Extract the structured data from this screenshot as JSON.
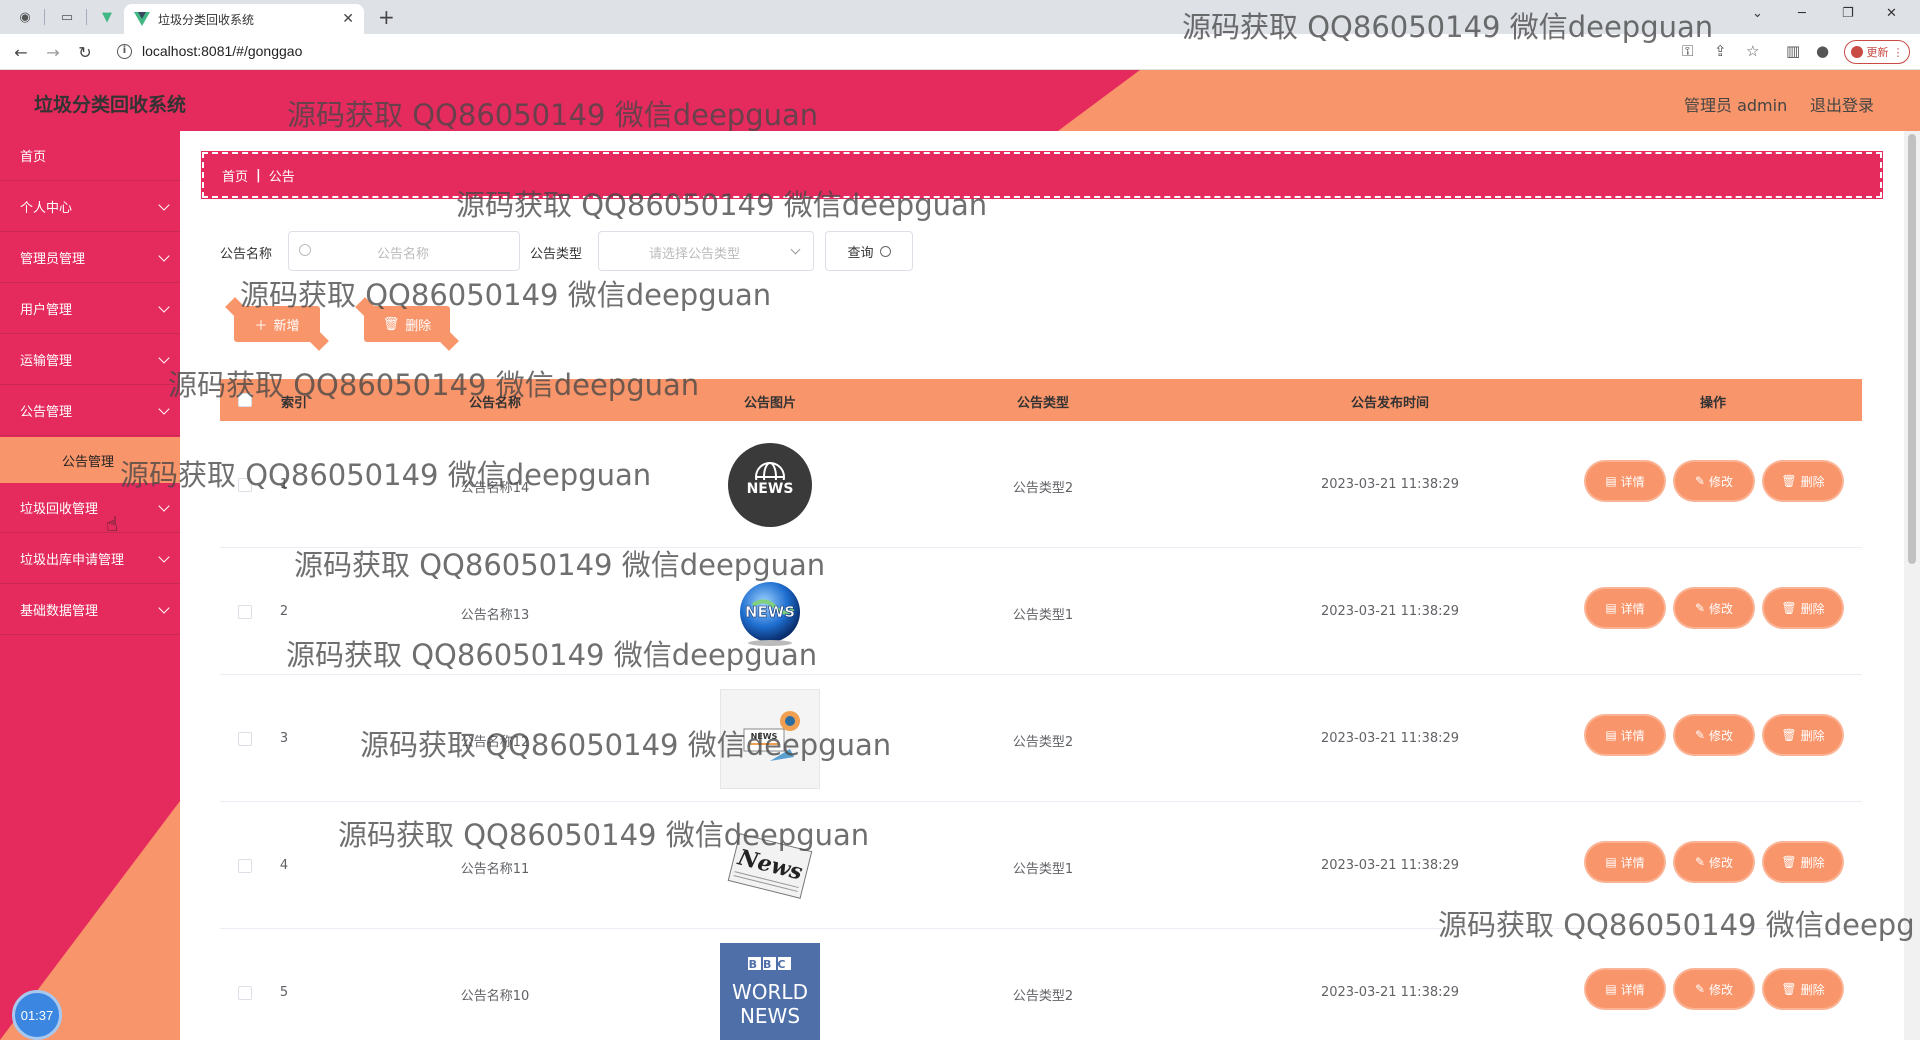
{
  "browser": {
    "tab_title": "垃圾分类回收系统",
    "url": "localhost:8081/#/gonggao",
    "update_label": "更新"
  },
  "header": {
    "app_title": "垃圾分类回收系统",
    "admin_label": "管理员 admin",
    "logout_label": "退出登录"
  },
  "sidebar": {
    "items": [
      {
        "label": "首页"
      },
      {
        "label": "个人中心"
      },
      {
        "label": "管理员管理"
      },
      {
        "label": "用户管理"
      },
      {
        "label": "运输管理"
      },
      {
        "label": "公告管理"
      },
      {
        "label": "垃圾回收管理"
      },
      {
        "label": "垃圾出库申请管理"
      },
      {
        "label": "基础数据管理"
      }
    ],
    "sub_item": "公告管理",
    "clock": "01:37"
  },
  "breadcrumb": {
    "home": "首页",
    "sep": "|",
    "current": "公告"
  },
  "search": {
    "name_label": "公告名称",
    "name_placeholder": "公告名称",
    "type_label": "公告类型",
    "type_placeholder": "请选择公告类型",
    "query_label": "查询"
  },
  "actions": {
    "add_label": "新增",
    "delete_label": "删除"
  },
  "table": {
    "headers": {
      "index": "索引",
      "name": "公告名称",
      "image": "公告图片",
      "type": "公告类型",
      "time": "公告发布时间",
      "ops": "操作"
    },
    "rows": [
      {
        "index": "1",
        "name": "公告名称14",
        "type": "公告类型2",
        "time": "2023-03-21 11:38:29",
        "image": "news-globe-black"
      },
      {
        "index": "2",
        "name": "公告名称13",
        "type": "公告类型1",
        "time": "2023-03-21 11:38:29",
        "image": "news-globe-blue"
      },
      {
        "index": "3",
        "name": "公告名称12",
        "type": "公告类型2",
        "time": "2023-03-21 11:38:29",
        "image": "news-megaphone"
      },
      {
        "index": "4",
        "name": "公告名称11",
        "type": "公告类型1",
        "time": "2023-03-21 11:38:29",
        "image": "newspaper"
      },
      {
        "index": "5",
        "name": "公告名称10",
        "type": "公告类型2",
        "time": "2023-03-21 11:38:29",
        "image": "bbc-world-news"
      }
    ],
    "op_labels": {
      "detail": "详情",
      "edit": "修改",
      "delete": "删除"
    }
  },
  "watermark": "源码获取 QQ86050149 微信deepguan",
  "watermark_cut": "源码获取 QQ86050149 微信deepg",
  "thumb_text": {
    "news": "NEWS",
    "news_script": "News",
    "bbc": "BBC",
    "world": "WORLD",
    "news_bbc": "NEWS"
  },
  "colors": {
    "primary": "#e52b5d",
    "accent": "#f9956a"
  }
}
